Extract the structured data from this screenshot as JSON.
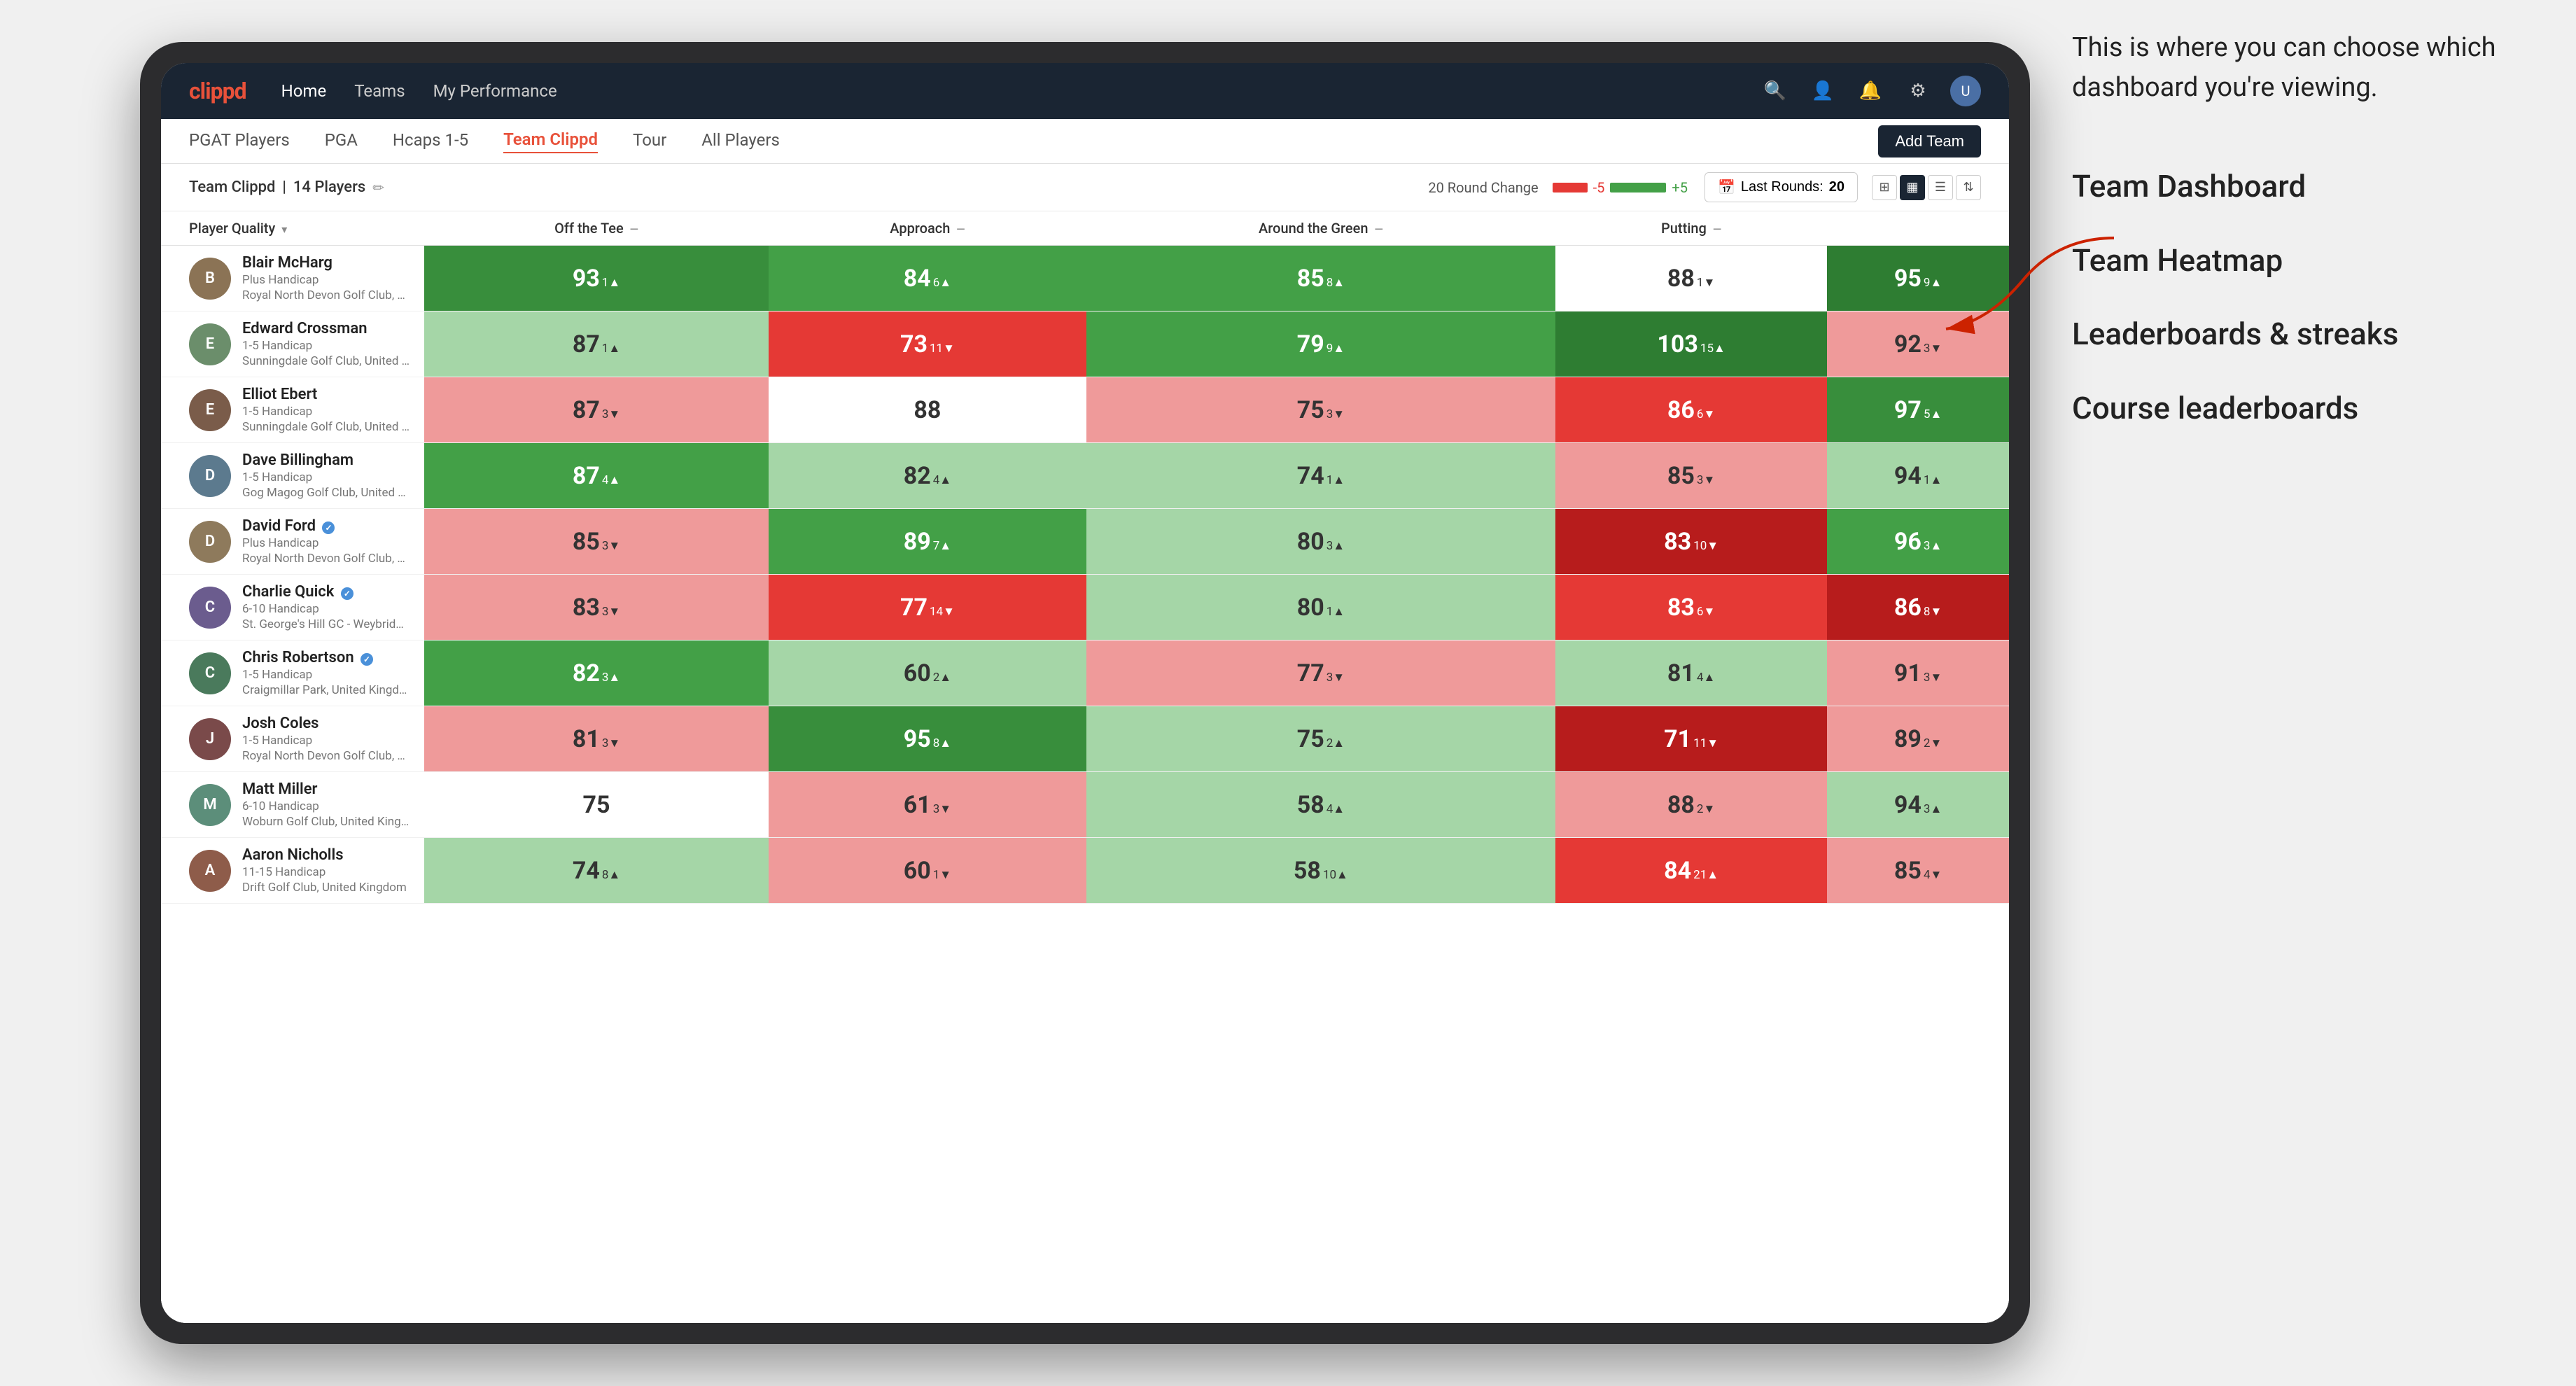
{
  "annotation": {
    "intro": "This is where you can choose which dashboard you're viewing.",
    "options": [
      "Team Dashboard",
      "Team Heatmap",
      "Leaderboards & streaks",
      "Course leaderboards"
    ]
  },
  "nav": {
    "logo": "clippd",
    "links": [
      "Home",
      "Teams",
      "My Performance"
    ],
    "active_link": "Home"
  },
  "sub_nav": {
    "links": [
      "PGAT Players",
      "PGA",
      "Hcaps 1-5",
      "Team Clippd",
      "Tour",
      "All Players"
    ],
    "active_link": "Team Clippd",
    "add_team_label": "Add Team"
  },
  "team_header": {
    "name": "Team Clippd",
    "player_count": "14 Players",
    "round_change_label": "20 Round Change",
    "range_low": "-5",
    "range_high": "+5",
    "last_rounds_label": "Last Rounds:",
    "last_rounds_value": "20"
  },
  "columns": {
    "player": "Player Quality",
    "off_tee": "Off the Tee",
    "approach": "Approach",
    "around_green": "Around the Green",
    "putting": "Putting"
  },
  "players": [
    {
      "name": "Blair McHarg",
      "handicap": "Plus Handicap",
      "club": "Royal North Devon Golf Club, United Kingdom",
      "verified": false,
      "avatar_color": "#8B7355",
      "scores": {
        "quality": {
          "value": 93,
          "change": "1",
          "dir": "up",
          "color": "green-bright"
        },
        "off_tee": {
          "value": 84,
          "change": "6",
          "dir": "up",
          "color": "green-mid"
        },
        "approach": {
          "value": 85,
          "change": "8",
          "dir": "up",
          "color": "green-mid"
        },
        "around_green": {
          "value": 88,
          "change": "1",
          "dir": "down",
          "color": "white-cell"
        },
        "putting": {
          "value": 95,
          "change": "9",
          "dir": "up",
          "color": "green-dark"
        }
      }
    },
    {
      "name": "Edward Crossman",
      "handicap": "1-5 Handicap",
      "club": "Sunningdale Golf Club, United Kingdom",
      "verified": false,
      "avatar_color": "#6B8E6B",
      "scores": {
        "quality": {
          "value": 87,
          "change": "1",
          "dir": "up",
          "color": "green-pale"
        },
        "off_tee": {
          "value": 73,
          "change": "11",
          "dir": "down",
          "color": "red-mid"
        },
        "approach": {
          "value": 79,
          "change": "9",
          "dir": "up",
          "color": "green-mid"
        },
        "around_green": {
          "value": 103,
          "change": "15",
          "dir": "up",
          "color": "green-dark"
        },
        "putting": {
          "value": 92,
          "change": "3",
          "dir": "down",
          "color": "red-light"
        }
      }
    },
    {
      "name": "Elliot Ebert",
      "handicap": "1-5 Handicap",
      "club": "Sunningdale Golf Club, United Kingdom",
      "verified": false,
      "avatar_color": "#7A5C4A",
      "scores": {
        "quality": {
          "value": 87,
          "change": "3",
          "dir": "down",
          "color": "red-light"
        },
        "off_tee": {
          "value": 88,
          "change": "",
          "dir": "",
          "color": "white-cell"
        },
        "approach": {
          "value": 75,
          "change": "3",
          "dir": "down",
          "color": "red-light"
        },
        "around_green": {
          "value": 86,
          "change": "6",
          "dir": "down",
          "color": "red-mid"
        },
        "putting": {
          "value": 97,
          "change": "5",
          "dir": "up",
          "color": "green-bright"
        }
      }
    },
    {
      "name": "Dave Billingham",
      "handicap": "1-5 Handicap",
      "club": "Gog Magog Golf Club, United Kingdom",
      "verified": false,
      "avatar_color": "#5C7A8E",
      "scores": {
        "quality": {
          "value": 87,
          "change": "4",
          "dir": "up",
          "color": "green-mid"
        },
        "off_tee": {
          "value": 82,
          "change": "4",
          "dir": "up",
          "color": "green-pale"
        },
        "approach": {
          "value": 74,
          "change": "1",
          "dir": "up",
          "color": "green-pale"
        },
        "around_green": {
          "value": 85,
          "change": "3",
          "dir": "down",
          "color": "red-light"
        },
        "putting": {
          "value": 94,
          "change": "1",
          "dir": "up",
          "color": "green-pale"
        }
      }
    },
    {
      "name": "David Ford",
      "handicap": "Plus Handicap",
      "club": "Royal North Devon Golf Club, United Kingdom",
      "verified": true,
      "avatar_color": "#8E7A5C",
      "scores": {
        "quality": {
          "value": 85,
          "change": "3",
          "dir": "down",
          "color": "red-light"
        },
        "off_tee": {
          "value": 89,
          "change": "7",
          "dir": "up",
          "color": "green-mid"
        },
        "approach": {
          "value": 80,
          "change": "3",
          "dir": "up",
          "color": "green-pale"
        },
        "around_green": {
          "value": 83,
          "change": "10",
          "dir": "down",
          "color": "red-dark"
        },
        "putting": {
          "value": 96,
          "change": "3",
          "dir": "up",
          "color": "green-mid"
        }
      }
    },
    {
      "name": "Charlie Quick",
      "handicap": "6-10 Handicap",
      "club": "St. George's Hill GC - Weybridge - Surrey, Uni...",
      "verified": true,
      "avatar_color": "#6B5C8E",
      "scores": {
        "quality": {
          "value": 83,
          "change": "3",
          "dir": "down",
          "color": "red-light"
        },
        "off_tee": {
          "value": 77,
          "change": "14",
          "dir": "down",
          "color": "red-mid"
        },
        "approach": {
          "value": 80,
          "change": "1",
          "dir": "up",
          "color": "green-pale"
        },
        "around_green": {
          "value": 83,
          "change": "6",
          "dir": "down",
          "color": "red-mid"
        },
        "putting": {
          "value": 86,
          "change": "8",
          "dir": "down",
          "color": "red-dark"
        }
      }
    },
    {
      "name": "Chris Robertson",
      "handicap": "1-5 Handicap",
      "club": "Craigmillar Park, United Kingdom",
      "verified": true,
      "avatar_color": "#4A7A5C",
      "scores": {
        "quality": {
          "value": 82,
          "change": "3",
          "dir": "up",
          "color": "green-mid"
        },
        "off_tee": {
          "value": 60,
          "change": "2",
          "dir": "up",
          "color": "green-pale"
        },
        "approach": {
          "value": 77,
          "change": "3",
          "dir": "down",
          "color": "red-light"
        },
        "around_green": {
          "value": 81,
          "change": "4",
          "dir": "up",
          "color": "green-pale"
        },
        "putting": {
          "value": 91,
          "change": "3",
          "dir": "down",
          "color": "red-light"
        }
      }
    },
    {
      "name": "Josh Coles",
      "handicap": "1-5 Handicap",
      "club": "Royal North Devon Golf Club, United Kingdom",
      "verified": false,
      "avatar_color": "#7A4A4A",
      "scores": {
        "quality": {
          "value": 81,
          "change": "3",
          "dir": "down",
          "color": "red-light"
        },
        "off_tee": {
          "value": 95,
          "change": "8",
          "dir": "up",
          "color": "green-bright"
        },
        "approach": {
          "value": 75,
          "change": "2",
          "dir": "up",
          "color": "green-pale"
        },
        "around_green": {
          "value": 71,
          "change": "11",
          "dir": "down",
          "color": "red-dark"
        },
        "putting": {
          "value": 89,
          "change": "2",
          "dir": "down",
          "color": "red-light"
        }
      }
    },
    {
      "name": "Matt Miller",
      "handicap": "6-10 Handicap",
      "club": "Woburn Golf Club, United Kingdom",
      "verified": false,
      "avatar_color": "#5C8E7A",
      "scores": {
        "quality": {
          "value": 75,
          "change": "",
          "dir": "",
          "color": "white-cell"
        },
        "off_tee": {
          "value": 61,
          "change": "3",
          "dir": "down",
          "color": "red-light"
        },
        "approach": {
          "value": 58,
          "change": "4",
          "dir": "up",
          "color": "green-pale"
        },
        "around_green": {
          "value": 88,
          "change": "2",
          "dir": "down",
          "color": "red-light"
        },
        "putting": {
          "value": 94,
          "change": "3",
          "dir": "up",
          "color": "green-pale"
        }
      }
    },
    {
      "name": "Aaron Nicholls",
      "handicap": "11-15 Handicap",
      "club": "Drift Golf Club, United Kingdom",
      "verified": false,
      "avatar_color": "#8E5C4A",
      "scores": {
        "quality": {
          "value": 74,
          "change": "8",
          "dir": "up",
          "color": "green-pale"
        },
        "off_tee": {
          "value": 60,
          "change": "1",
          "dir": "down",
          "color": "red-light"
        },
        "approach": {
          "value": 58,
          "change": "10",
          "dir": "up",
          "color": "green-pale"
        },
        "around_green": {
          "value": 84,
          "change": "21",
          "dir": "up",
          "color": "red-mid"
        },
        "putting": {
          "value": 85,
          "change": "4",
          "dir": "down",
          "color": "red-light"
        }
      }
    }
  ]
}
